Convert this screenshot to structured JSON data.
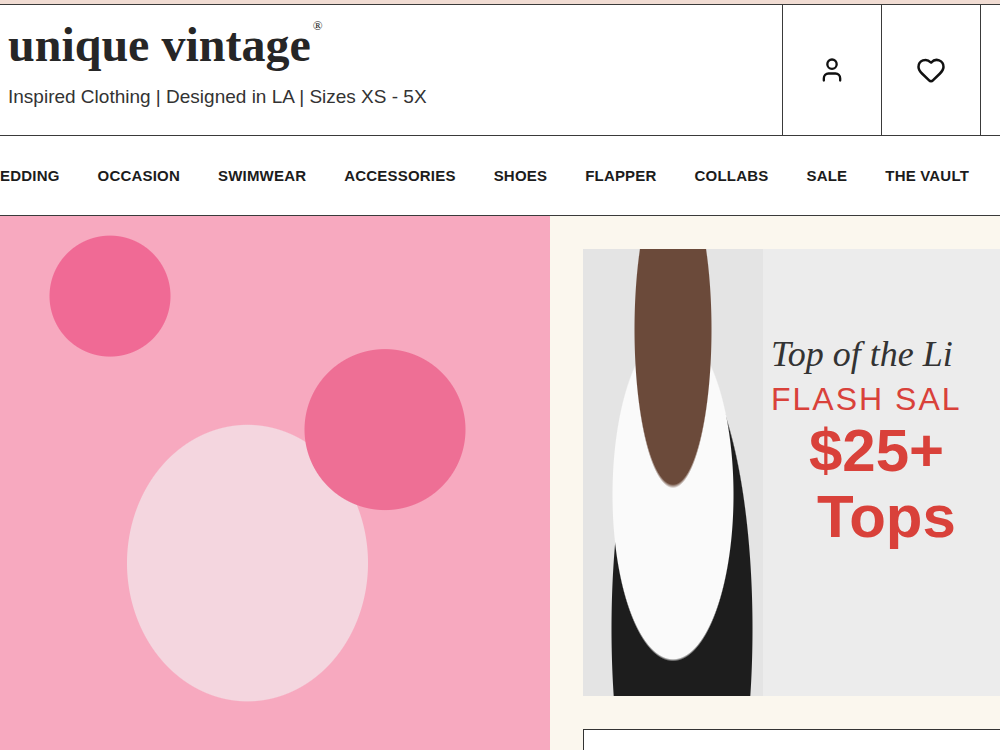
{
  "header": {
    "logo": "unique vintage",
    "logo_mark": "®",
    "tagline": "Inspired Clothing | Designed in LA | Sizes XS - 5X"
  },
  "icons": [
    "account",
    "wishlist"
  ],
  "nav": {
    "items": [
      "EDDING",
      "OCCASION",
      "SWIMWEAR",
      "ACCESSORIES",
      "SHOES",
      "FLAPPER",
      "COLLABS",
      "SALE",
      "THE VAULT"
    ]
  },
  "promo": {
    "script": "Top of the Li",
    "headline": "FLASH SAL",
    "price": "$25+",
    "category": "Tops"
  }
}
